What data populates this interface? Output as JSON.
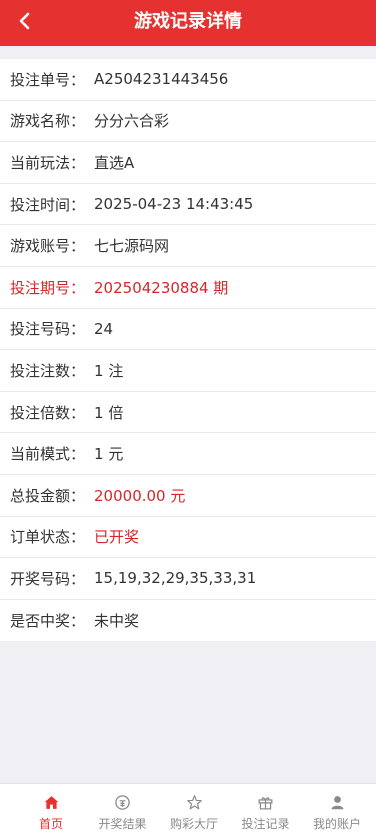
{
  "header": {
    "title": "游戏记录详情",
    "back_icon": "chevron-left-icon"
  },
  "details": [
    {
      "label": "投注单号：",
      "value": "A2504231443456"
    },
    {
      "label": "游戏名称：",
      "value": "分分六合彩"
    },
    {
      "label": "当前玩法：",
      "value": "直选A"
    },
    {
      "label": "投注时间：",
      "value": "2025-04-23 14:43:45"
    },
    {
      "label": "游戏账号：",
      "value": "七七源码网"
    },
    {
      "label": "投注期号：",
      "value": "202504230884 期"
    },
    {
      "label": "投注号码：",
      "value": "24"
    },
    {
      "label": "投注注数：",
      "value": "1 注"
    },
    {
      "label": "投注倍数：",
      "value": "1 倍"
    },
    {
      "label": "当前模式：",
      "value": "1 元"
    },
    {
      "label": "总投金额：",
      "value": "20000.00 元"
    },
    {
      "label": "订单状态：",
      "value": "已开奖"
    },
    {
      "label": "开奖号码：",
      "value": "15,19,32,29,35,33,31"
    },
    {
      "label": "是否中奖：",
      "value": "未中奖"
    }
  ],
  "tabbar": [
    {
      "label": "首页",
      "icon": "home-icon",
      "active": true
    },
    {
      "label": "开奖结果",
      "icon": "lottery-result-icon",
      "active": false
    },
    {
      "label": "购彩大厅",
      "icon": "star-icon",
      "active": false
    },
    {
      "label": "投注记录",
      "icon": "gift-icon",
      "active": false
    },
    {
      "label": "我的账户",
      "icon": "user-icon",
      "active": false
    }
  ],
  "colors": {
    "accent": "#e5312f",
    "highlight": "#d6262a"
  }
}
